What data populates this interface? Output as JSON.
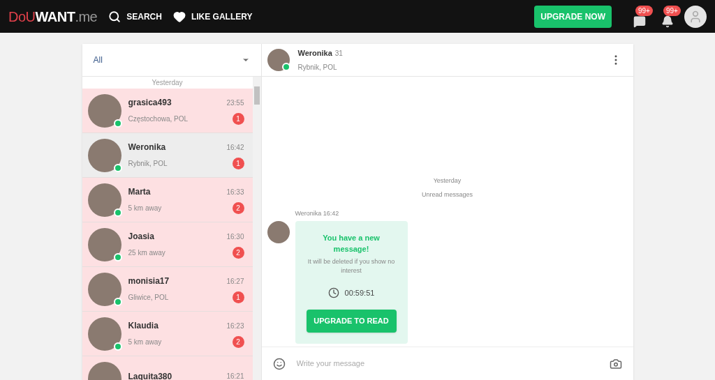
{
  "header": {
    "logo": {
      "part_1": "DoU",
      "part_2": "WANT",
      "part_3": ".me"
    },
    "nav": [
      {
        "label": "SEARCH"
      },
      {
        "label": "LIKE GALLERY"
      }
    ],
    "upgrade_button": "UPGRADE NOW",
    "notifications": [
      {
        "count": "99+"
      },
      {
        "count": "99+"
      }
    ]
  },
  "filter": {
    "value": "All"
  },
  "list_section": "Yesterday",
  "conversations": [
    {
      "name": "grasica493",
      "location": "Częstochowa, POL",
      "time": "23:55",
      "unread": "1",
      "online": true,
      "selected": false
    },
    {
      "name": "Weronika",
      "location": "Rybnik, POL",
      "time": "16:42",
      "unread": "1",
      "online": true,
      "selected": true
    },
    {
      "name": "Marta",
      "location": "5 km away",
      "time": "16:33",
      "unread": "2",
      "online": true,
      "selected": false
    },
    {
      "name": "Joasia",
      "location": "25 km away",
      "time": "16:30",
      "unread": "2",
      "online": true,
      "selected": false
    },
    {
      "name": "monisia17",
      "location": "Gliwice, POL",
      "time": "16:27",
      "unread": "1",
      "online": true,
      "selected": false
    },
    {
      "name": "Klaudia",
      "location": "5 km away",
      "time": "16:23",
      "unread": "2",
      "online": true,
      "selected": false
    },
    {
      "name": "Laquita380",
      "time": "16:21",
      "selected": false
    }
  ],
  "chat": {
    "name": "Weronika",
    "age": "31",
    "location": "Rybnik, POL",
    "online": true,
    "day": "Yesterday",
    "unread_label": "Unread messages",
    "message": {
      "sender": "Weronika 16:42",
      "title": "You have a new message!",
      "note": "It will be deleted if you show no interest",
      "timer": "00:59:51",
      "button": "UPGRADE TO READ"
    },
    "input": {
      "placeholder": "Write your message"
    }
  }
}
